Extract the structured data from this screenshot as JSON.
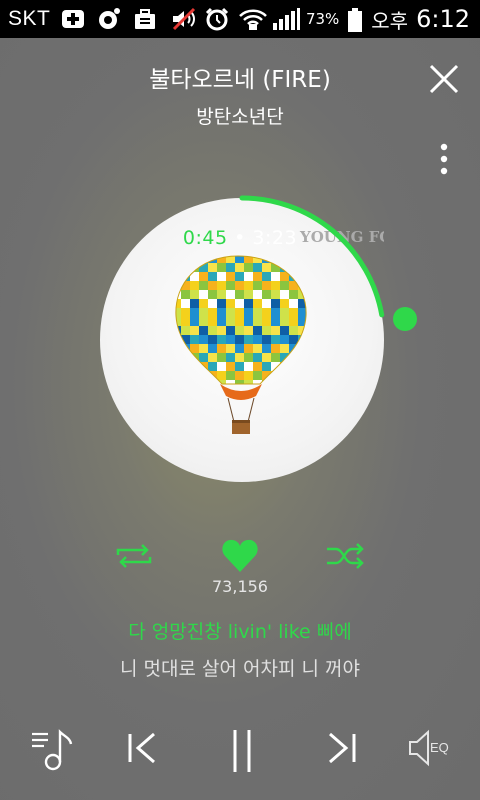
{
  "status_bar": {
    "carrier": "SKT",
    "battery_percent": "73%",
    "ampm": "오후",
    "time": "6:12",
    "icons": [
      "medical-cross-icon",
      "circle-notification-icon",
      "briefcase-icon",
      "mute-icon",
      "alarm-clock-icon",
      "wifi-lock-icon",
      "signal-bars-icon",
      "battery-icon"
    ]
  },
  "header": {
    "title": "불타오르네 (FIRE)",
    "artist": "방탄소년단",
    "close_icon": "close-icon",
    "more_icon": "more-vertical-icon"
  },
  "player": {
    "elapsed": "0:45",
    "separator": "•",
    "duration": "3:23",
    "progress_fraction": 0.2217,
    "album_art": "hot-air-balloon",
    "album_text": "YOUNG FOREVER"
  },
  "actions": {
    "repeat_icon": "repeat-icon",
    "like_icon": "heart-icon",
    "shuffle_icon": "shuffle-icon",
    "like_count": "73,156"
  },
  "lyrics": {
    "current": "다 엉망진창 livin' like 삐에",
    "next": "니 멋대로 살어 어차피 니 꺼야"
  },
  "controls": {
    "playlist_icon": "playlist-music-icon",
    "prev_icon": "previous-icon",
    "pause_icon": "pause-icon",
    "next_icon": "next-icon",
    "eq_icon": "speaker-eq-icon",
    "eq_label": "EQ"
  },
  "colors": {
    "accent": "#2fd84a",
    "background": "#6f6f6f",
    "status_bar": "#000000",
    "text": "#ffffff"
  }
}
